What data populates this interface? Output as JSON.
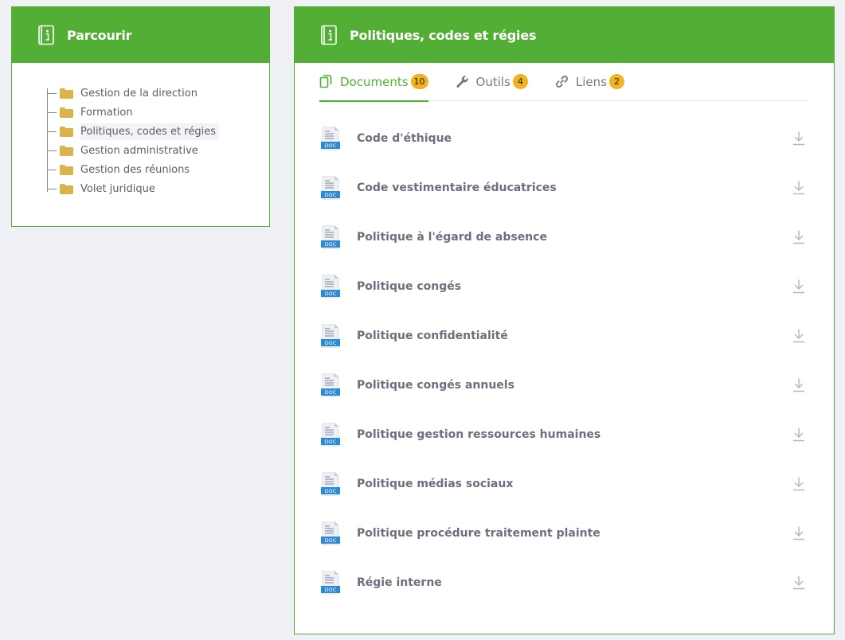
{
  "browse": {
    "title": "Parcourir",
    "items": [
      {
        "label": "Gestion de la direction"
      },
      {
        "label": "Formation"
      },
      {
        "label": "Politiques, codes et régies"
      },
      {
        "label": "Gestion administrative"
      },
      {
        "label": "Gestion des réunions"
      },
      {
        "label": "Volet juridique"
      }
    ],
    "active_index": 2
  },
  "section": {
    "title": "Politiques, codes et régies",
    "tabs": [
      {
        "label": "Documents",
        "count": "10",
        "icon": "documents-icon"
      },
      {
        "label": "Outils",
        "count": "4",
        "icon": "wrench-icon"
      },
      {
        "label": "Liens",
        "count": "2",
        "icon": "link-icon"
      }
    ],
    "active_tab": 0,
    "documents": [
      {
        "name": "Code d'éthique",
        "type": "DOC"
      },
      {
        "name": "Code vestimentaire éducatrices",
        "type": "DOC"
      },
      {
        "name": "Politique à l'égard de absence",
        "type": "DOC"
      },
      {
        "name": "Politique congés",
        "type": "DOC"
      },
      {
        "name": "Politique confidentialité",
        "type": "DOC"
      },
      {
        "name": "Politique congés annuels",
        "type": "DOC"
      },
      {
        "name": "Politique gestion ressources humaines",
        "type": "DOC"
      },
      {
        "name": "Politique médias sociaux",
        "type": "DOC"
      },
      {
        "name": "Politique procédure traitement plainte",
        "type": "DOC"
      },
      {
        "name": "Régie interne",
        "type": "DOC"
      }
    ]
  },
  "colors": {
    "brand_green": "#52ae34",
    "badge_yellow": "#f2b31d",
    "folder_yellow": "#d9b44a",
    "doc_blue": "#2d8ad8"
  }
}
